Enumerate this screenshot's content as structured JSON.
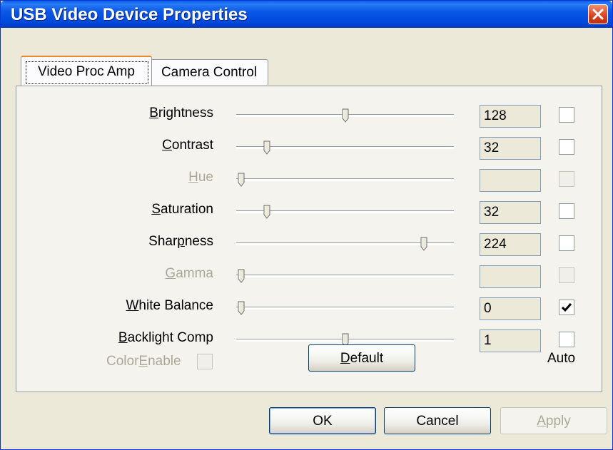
{
  "window": {
    "title": "USB Video Device Properties",
    "close_icon": "close-icon"
  },
  "tabs": [
    {
      "label": "Video Proc Amp",
      "active": true
    },
    {
      "label": "Camera Control",
      "active": false
    }
  ],
  "rows": [
    {
      "pre": "",
      "acc": "B",
      "post": "rightness",
      "value": "128",
      "level": 0.5,
      "auto": false,
      "enabled": true
    },
    {
      "pre": "",
      "acc": "C",
      "post": "ontrast",
      "value": "32",
      "level": 0.125,
      "auto": false,
      "enabled": true
    },
    {
      "pre": "",
      "acc": "H",
      "post": "ue",
      "value": "",
      "level": 0,
      "auto": false,
      "enabled": false
    },
    {
      "pre": "",
      "acc": "S",
      "post": "aturation",
      "value": "32",
      "level": 0.125,
      "auto": false,
      "enabled": true
    },
    {
      "pre": "Shar",
      "acc": "p",
      "post": "ness",
      "value": "224",
      "level": 0.88,
      "auto": false,
      "enabled": true
    },
    {
      "pre": "",
      "acc": "G",
      "post": "amma",
      "value": "",
      "level": 0,
      "auto": false,
      "enabled": false
    },
    {
      "pre": "",
      "acc": "W",
      "post": "hite Balance",
      "value": "0",
      "level": 0,
      "auto": true,
      "enabled": true
    },
    {
      "pre": "",
      "acc": "B",
      "post": "acklight Comp",
      "value": "1",
      "level": 0.5,
      "auto": false,
      "enabled": true
    }
  ],
  "color_enable": {
    "pre": "Color",
    "acc": "E",
    "post": "nable",
    "checked": false
  },
  "default_button": {
    "pre": "",
    "acc": "D",
    "post": "efault"
  },
  "auto_header": "Auto",
  "buttons": {
    "ok": "OK",
    "cancel": "Cancel",
    "apply": {
      "pre": "",
      "acc": "A",
      "post": "pply"
    }
  },
  "colors": {
    "title_bar": "#0a58e6",
    "close_button": "#d84020",
    "dialog_bg": "#ece9d8",
    "active_tab_accent": "#e68b2c"
  }
}
